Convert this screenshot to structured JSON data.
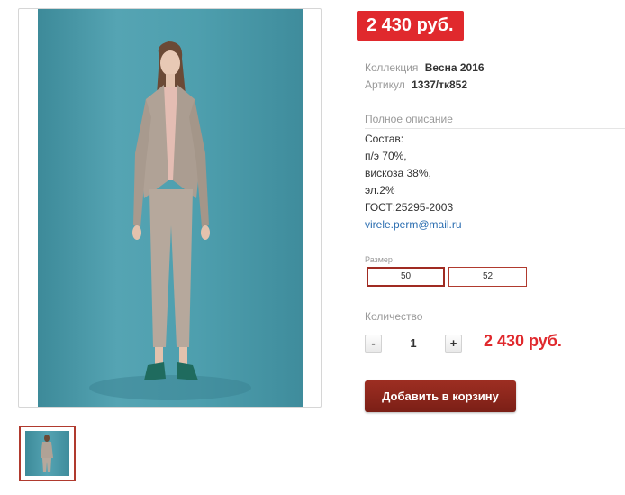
{
  "product": {
    "price_badge": "2 430 руб.",
    "collection_label": "Коллекция",
    "collection_value": "Весна 2016",
    "article_label": "Артикул",
    "article_value": "1337/тк852",
    "description_title": "Полное описание",
    "description_lines": [
      "Состав:",
      "п/э 70%,",
      "вискоза 38%,",
      "эл.2%",
      "ГОСТ:25295-2003"
    ],
    "email": "virele.perm@mail.ru",
    "size_label": "Размер",
    "sizes": [
      {
        "label": "50",
        "selected": true
      },
      {
        "label": "52",
        "selected": false
      }
    ],
    "quantity_label": "Количество",
    "qty_minus": "-",
    "qty_value": "1",
    "qty_plus": "+",
    "total_price": "2 430 руб.",
    "add_to_cart": "Добавить в корзину"
  },
  "colors": {
    "price_red": "#e0292d",
    "button_dark_red": "#8a251b",
    "link_blue": "#2a6db0",
    "photo_background": "#4e9fae"
  }
}
